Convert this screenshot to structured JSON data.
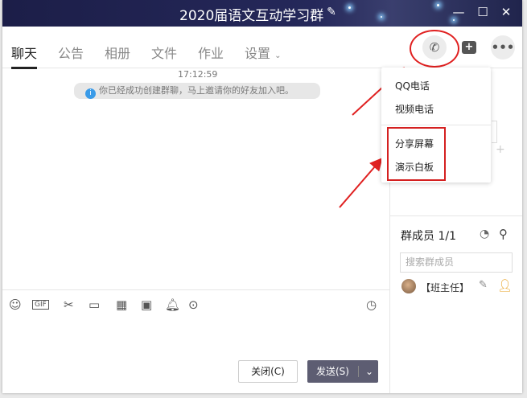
{
  "window": {
    "title": "2020届语文互动学习群"
  },
  "tabs": [
    {
      "label": "聊天"
    },
    {
      "label": "公告"
    },
    {
      "label": "相册"
    },
    {
      "label": "文件"
    },
    {
      "label": "作业"
    },
    {
      "label": "设置"
    }
  ],
  "chat": {
    "time": "17:12:59",
    "notice": "你已经成功创建群聊，马上邀请你的好友加入吧。"
  },
  "call_menu": {
    "items": [
      {
        "label": "QQ电话"
      },
      {
        "label": "视频电话"
      },
      {
        "label": "分享屏幕"
      },
      {
        "label": "演示白板"
      }
    ]
  },
  "toolbar": {
    "gif_label": "GIF"
  },
  "buttons": {
    "close": "关闭(C)",
    "send": "发送(S)"
  },
  "members": {
    "title": "群成员 1/1",
    "search_placeholder": "搜索群成员",
    "list": [
      {
        "name": "【班主任】"
      }
    ]
  },
  "colors": {
    "highlight": "#d42020",
    "send": "#5d5d72"
  }
}
